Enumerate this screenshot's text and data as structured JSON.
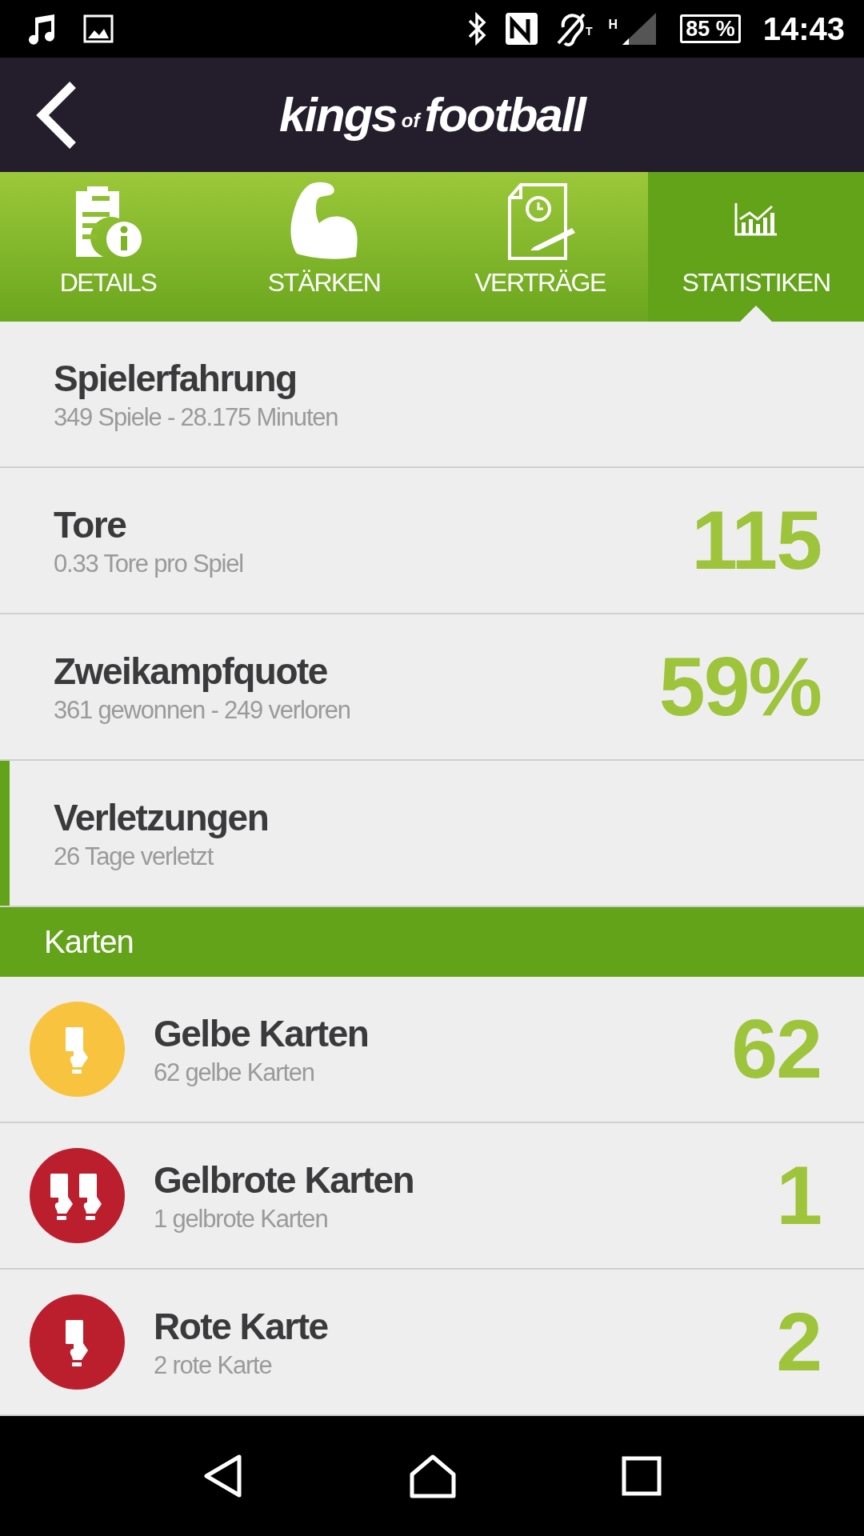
{
  "status_bar": {
    "network_type": "H",
    "hearing_mode": "T",
    "battery": "85 %",
    "time": "14:43"
  },
  "header": {
    "logo_main": "kings",
    "logo_small": "of",
    "logo_end": "football"
  },
  "tabs": [
    {
      "kind": "details",
      "label": "DETAILS",
      "selected": false
    },
    {
      "kind": "strength",
      "label": "STÄRKEN",
      "selected": false
    },
    {
      "kind": "contract",
      "label": "VERTRÄGE",
      "selected": false
    },
    {
      "kind": "stats",
      "label": "STATISTIKEN",
      "selected": true
    }
  ],
  "stats": [
    {
      "title": "Spielerfahrung",
      "subtitle": "349 Spiele - 28.175 Minuten",
      "selected": false
    },
    {
      "title": "Tore",
      "subtitle": "0.33 Tore pro Spiel",
      "value": "115",
      "selected": false
    },
    {
      "title": "Zweikampfquote",
      "subtitle": "361 gewonnen - 249 verloren",
      "value": "59%",
      "selected": false
    },
    {
      "title": "Verletzungen",
      "subtitle": "26 Tage verletzt",
      "selected": true
    }
  ],
  "cards_section": {
    "title": "Karten"
  },
  "cards": [
    {
      "kind": "single",
      "color": "#f8c440",
      "title": "Gelbe Karten",
      "subtitle": "62 gelbe Karten",
      "value": "62"
    },
    {
      "kind": "double",
      "color": "#bb1f2e",
      "title": "Gelbrote Karten",
      "subtitle": "1 gelbrote Karten",
      "value": "1"
    },
    {
      "kind": "single",
      "color": "#bb1f2e",
      "title": "Rote Karte",
      "subtitle": "2 rote Karte",
      "value": "2"
    }
  ]
}
